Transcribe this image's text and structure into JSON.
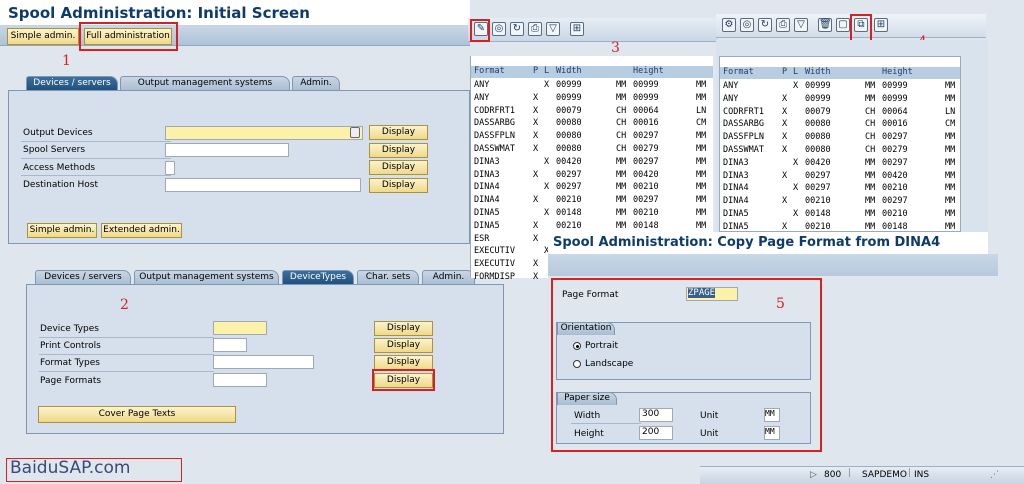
{
  "title": "Spool Administration: Initial Screen",
  "top_buttons": {
    "simple": "Simple admin.",
    "full": "Full administration"
  },
  "labels": {
    "n1": "1",
    "n2": "2",
    "n3": "3",
    "n4": "4",
    "n5": "5"
  },
  "panel1": {
    "tabs": [
      "Devices / servers",
      "Output management systems",
      "Admin."
    ],
    "rows": [
      "Output Devices",
      "Spool Servers",
      "Access Methods",
      "Destination Host"
    ],
    "display": "Display",
    "btn_simple": "Simple admin.",
    "btn_extended": "Extended admin."
  },
  "panel2": {
    "tabs": [
      "Devices / servers",
      "Output management systems",
      "DeviceTypes",
      "Char. sets",
      "Admin."
    ],
    "rows": [
      "Device Types",
      "Print Controls",
      "Format Types",
      "Page Formats"
    ],
    "display": "Display",
    "cover": "Cover Page Texts"
  },
  "grid3": {
    "headers": [
      "Format",
      "P",
      "L",
      "Width",
      "Height"
    ],
    "rows": [
      [
        "ANY",
        "",
        "X",
        "00999",
        "MM",
        "00999",
        "MM"
      ],
      [
        "ANY",
        "X",
        "",
        "00999",
        "MM",
        "00999",
        "MM"
      ],
      [
        "CODRFRT1",
        "X",
        "",
        "00079",
        "CH",
        "00064",
        "LN"
      ],
      [
        "DASSARBG",
        "X",
        "",
        "00080",
        "CH",
        "00016",
        "CM"
      ],
      [
        "DASSFPLN",
        "X",
        "",
        "00080",
        "CH",
        "00297",
        "MM"
      ],
      [
        "DASSWMAT",
        "X",
        "",
        "00080",
        "CH",
        "00279",
        "MM"
      ],
      [
        "DINA3",
        "",
        "X",
        "00420",
        "MM",
        "00297",
        "MM"
      ],
      [
        "DINA3",
        "X",
        "",
        "00297",
        "MM",
        "00420",
        "MM"
      ],
      [
        "DINA4",
        "",
        "X",
        "00297",
        "MM",
        "00210",
        "MM"
      ],
      [
        "DINA4",
        "X",
        "",
        "00210",
        "MM",
        "00297",
        "MM"
      ],
      [
        "DINA5",
        "",
        "X",
        "00148",
        "MM",
        "00210",
        "MM"
      ],
      [
        "DINA5",
        "X",
        "",
        "00210",
        "MM",
        "00148",
        "MM"
      ],
      [
        "ESR",
        "X",
        "",
        "",
        "",
        "",
        ""
      ],
      [
        "EXECUTIV",
        "",
        "X",
        "",
        "",
        "",
        ""
      ],
      [
        "EXECUTIV",
        "X",
        "",
        "",
        "",
        "",
        ""
      ],
      [
        "FORMDISP",
        "X",
        "",
        "",
        "",
        "",
        ""
      ]
    ]
  },
  "grid4": {
    "headers": [
      "Format",
      "P",
      "L",
      "Width",
      "Height"
    ],
    "rows": [
      [
        "ANY",
        "",
        "X",
        "00999",
        "MM",
        "00999",
        "MM"
      ],
      [
        "ANY",
        "X",
        "",
        "00999",
        "MM",
        "00999",
        "MM"
      ],
      [
        "CODRFRT1",
        "X",
        "",
        "00079",
        "CH",
        "00064",
        "LN"
      ],
      [
        "DASSARBG",
        "X",
        "",
        "00080",
        "CH",
        "00016",
        "CM"
      ],
      [
        "DASSFPLN",
        "X",
        "",
        "00080",
        "CH",
        "00297",
        "MM"
      ],
      [
        "DASSWMAT",
        "X",
        "",
        "00080",
        "CH",
        "00279",
        "MM"
      ],
      [
        "DINA3",
        "",
        "X",
        "00420",
        "MM",
        "00297",
        "MM"
      ],
      [
        "DINA3",
        "X",
        "",
        "00297",
        "MM",
        "00420",
        "MM"
      ],
      [
        "DINA4",
        "",
        "X",
        "00297",
        "MM",
        "00210",
        "MM"
      ],
      [
        "DINA4",
        "X",
        "",
        "00210",
        "MM",
        "00297",
        "MM"
      ],
      [
        "DINA5",
        "",
        "X",
        "00148",
        "MM",
        "00210",
        "MM"
      ],
      [
        "DINA5",
        "X",
        "",
        "00210",
        "MM",
        "00148",
        "MM"
      ]
    ]
  },
  "copy": {
    "title": "Spool Administration: Copy Page Format from DINA4",
    "page_format_label": "Page Format",
    "page_format_value": "ZPAGE",
    "orientation": "Orientation",
    "portrait": "Portrait",
    "landscape": "Landscape",
    "paper_size": "Paper size",
    "width_label": "Width",
    "width_value": "300",
    "height_label": "Height",
    "height_value": "200",
    "unit_label": "Unit",
    "unit_value": "MM"
  },
  "status": {
    "client": "800",
    "system": "SAPDEMO",
    "mode": "INS"
  },
  "watermark": "BaiduSAP.com"
}
